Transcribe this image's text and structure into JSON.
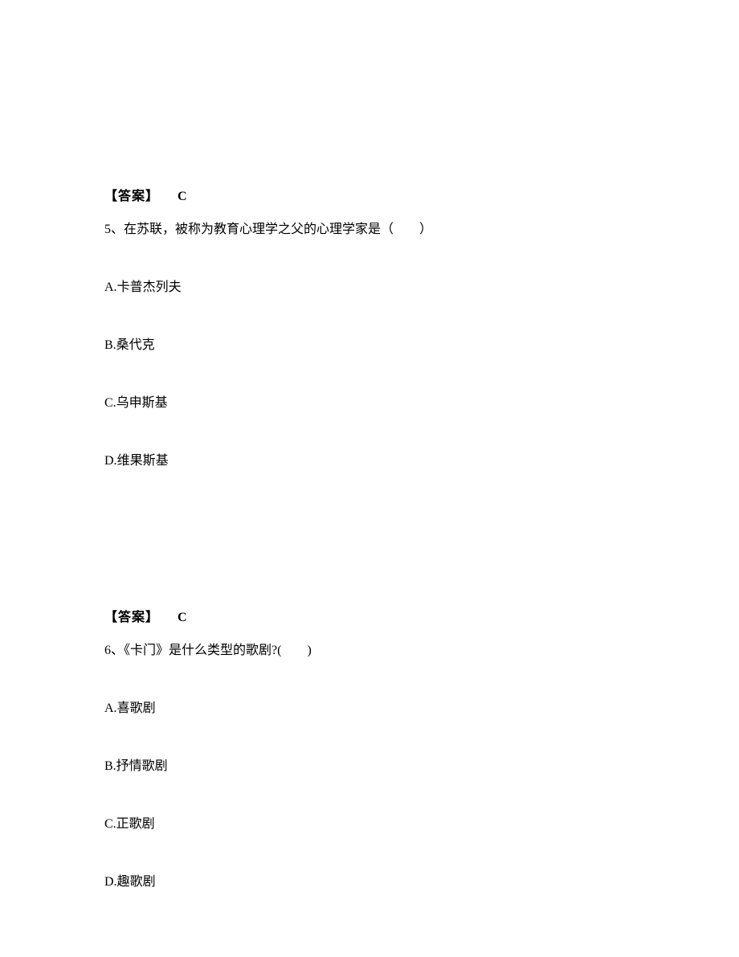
{
  "block1": {
    "answer_label": "【答案】",
    "answer_value": "C"
  },
  "question5": {
    "number": "5、",
    "text": "在苏联，被称为教育心理学之父的心理学家是（　　）",
    "options": {
      "a": {
        "letter": "A.",
        "text": "卡普杰列夫"
      },
      "b": {
        "letter": "B.",
        "text": "桑代克"
      },
      "c": {
        "letter": "C.",
        "text": "乌申斯基"
      },
      "d": {
        "letter": "D.",
        "text": "维果斯基"
      }
    }
  },
  "block2": {
    "answer_label": "【答案】",
    "answer_value": "C"
  },
  "question6": {
    "number": "6、",
    "text": "《卡门》是什么类型的歌剧?(　　)",
    "options": {
      "a": {
        "letter": "A.",
        "text": "喜歌剧"
      },
      "b": {
        "letter": "B.",
        "text": "抒情歌剧"
      },
      "c": {
        "letter": "C.",
        "text": "正歌剧"
      },
      "d": {
        "letter": "D.",
        "text": "趣歌剧"
      }
    }
  }
}
